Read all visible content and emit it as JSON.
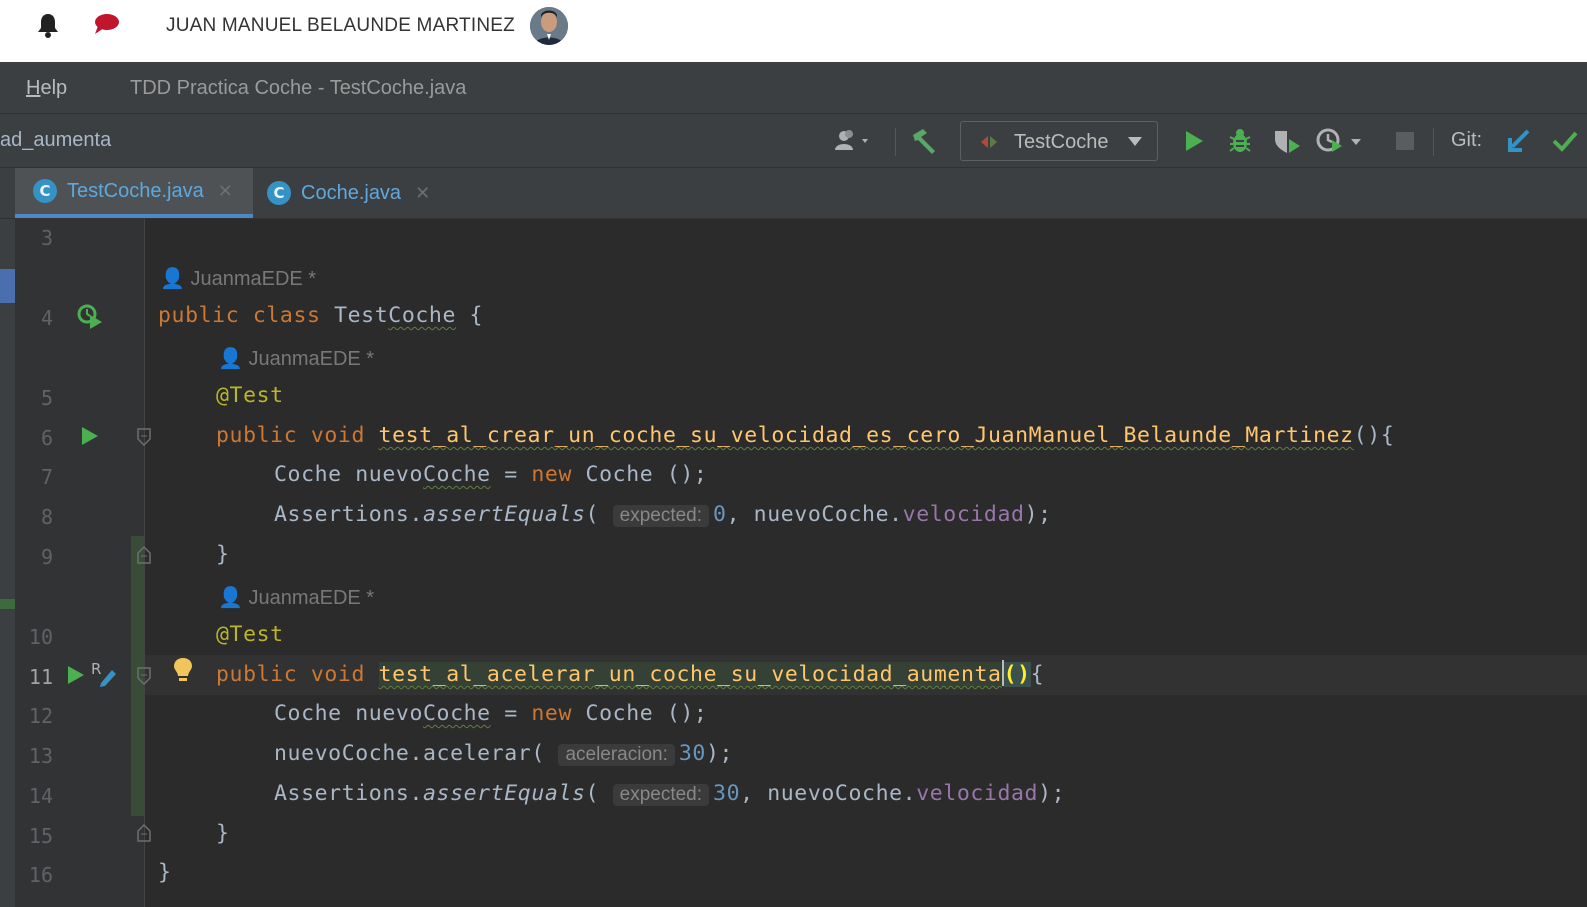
{
  "header": {
    "user_name": "JUAN MANUEL BELAUNDE MARTINEZ",
    "icons": [
      "bell-icon",
      "chat-icon",
      "avatar"
    ]
  },
  "menu": {
    "help_first": "H",
    "help_rest": "elp",
    "window_title": "TDD Practica Coche - TestCoche.java"
  },
  "navbar": {
    "breadcrumb": "ad_aumenta",
    "run_config": "TestCoche",
    "git_label": "Git:"
  },
  "tabs": [
    {
      "label": "TestCoche.java",
      "icon": "C",
      "active": true
    },
    {
      "label": "Coche.java",
      "icon": "C",
      "active": false
    }
  ],
  "editor": {
    "line_numbers": [
      "3",
      "4",
      "5",
      "6",
      "7",
      "8",
      "9",
      "10",
      "11",
      "12",
      "13",
      "14",
      "15",
      "16"
    ],
    "current_line": "11",
    "author": "JuanmaEDE *",
    "code": {
      "l4_kw1": "public",
      "l4_kw2": "class",
      "l4_name_pre": "Test",
      "l4_name_sq": "Coche",
      "l4_rest": " {",
      "annotation": "@Test",
      "l6_kw1": "public",
      "l6_kw2": "void",
      "method1": "test_al_crear_un_coche_su_velocidad_es_cero_JuanManuel_Belaunde_Martinez",
      "method1_tail": "(){",
      "l7_type": "Coche ",
      "l7_var_pre": "nuevo",
      "l7_var_sq": "Coche",
      "l7_eq": " = ",
      "l7_new": "new",
      "l7_rest": " Coche ();",
      "assert_cls": "Assertions.",
      "assert_m": "assertEquals",
      "open_paren": "( ",
      "hint_expected": "expected:",
      "l8_val": "0",
      "l8_rest_pre": ", nuevoCoche.",
      "field": "velocidad",
      "close": ");",
      "brace_close": "}",
      "method2": "test_al_acelerar_un_coche_su_velocidad_aumenta",
      "method2_paren": "()",
      "method2_tail": "{",
      "l13_call": "nuevoCoche.acelerar( ",
      "hint_acel": "aceleracion:",
      "l13_val": "30",
      "l14_val": "30"
    }
  },
  "colors": {
    "keyword": "#cc7832",
    "annotation": "#bbb529",
    "number": "#6897bb",
    "field": "#9876aa",
    "method": "#ffc66d",
    "run": "#4caf50",
    "accent": "#4a88c7"
  }
}
